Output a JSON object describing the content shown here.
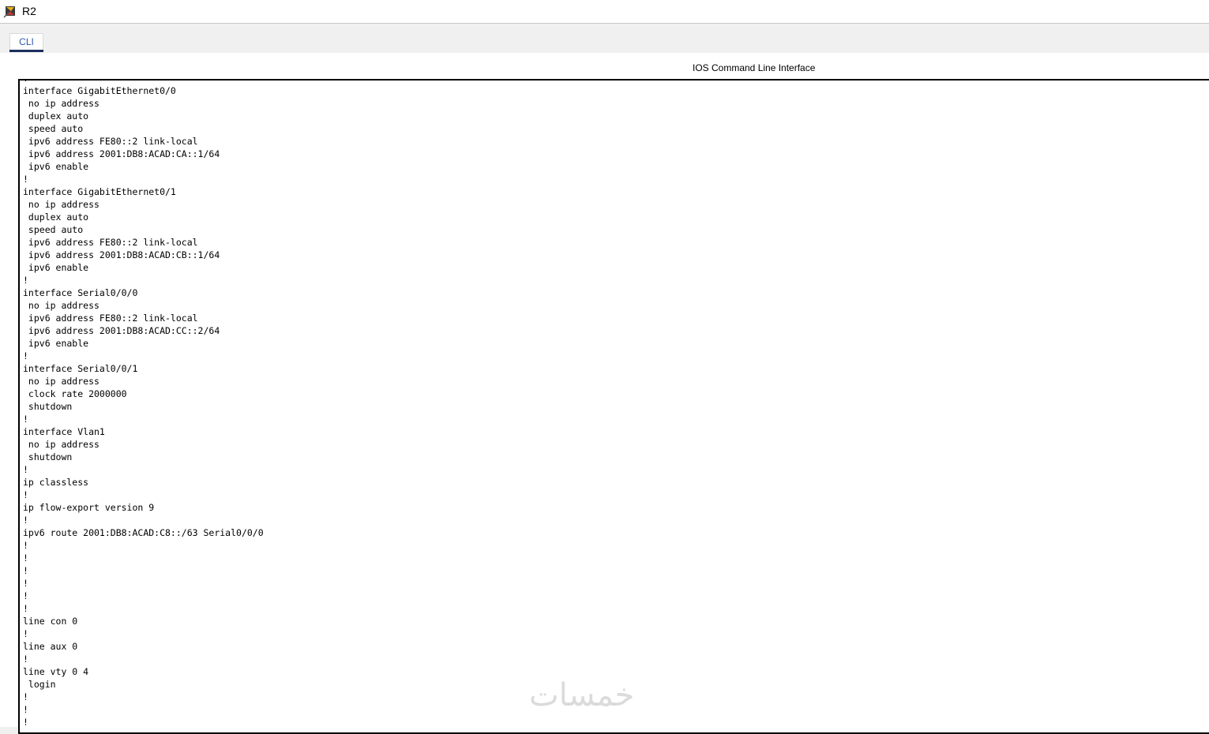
{
  "window": {
    "title": "R2",
    "icon": "packet-tracer-router-icon"
  },
  "tabs": [
    {
      "label": "CLI",
      "active": true
    }
  ],
  "panel": {
    "title": "IOS Command Line Interface"
  },
  "cli": {
    "lines": [
      "!",
      "interface GigabitEthernet0/0",
      " no ip address",
      " duplex auto",
      " speed auto",
      " ipv6 address FE80::2 link-local",
      " ipv6 address 2001:DB8:ACAD:CA::1/64",
      " ipv6 enable",
      "!",
      "interface GigabitEthernet0/1",
      " no ip address",
      " duplex auto",
      " speed auto",
      " ipv6 address FE80::2 link-local",
      " ipv6 address 2001:DB8:ACAD:CB::1/64",
      " ipv6 enable",
      "!",
      "interface Serial0/0/0",
      " no ip address",
      " ipv6 address FE80::2 link-local",
      " ipv6 address 2001:DB8:ACAD:CC::2/64",
      " ipv6 enable",
      "!",
      "interface Serial0/0/1",
      " no ip address",
      " clock rate 2000000",
      " shutdown",
      "!",
      "interface Vlan1",
      " no ip address",
      " shutdown",
      "!",
      "ip classless",
      "!",
      "ip flow-export version 9",
      "!",
      "ipv6 route 2001:DB8:ACAD:C8::/63 Serial0/0/0",
      "!",
      "!",
      "!",
      "!",
      "!",
      "!",
      "line con 0",
      "!",
      "line aux 0",
      "!",
      "line vty 0 4",
      " login",
      "!",
      "!",
      "!"
    ]
  },
  "watermark": {
    "text": "خمسات"
  },
  "colors": {
    "tab_text": "#2a5aa8",
    "tab_underline": "#1b2f5e",
    "cli_border": "#000000"
  }
}
